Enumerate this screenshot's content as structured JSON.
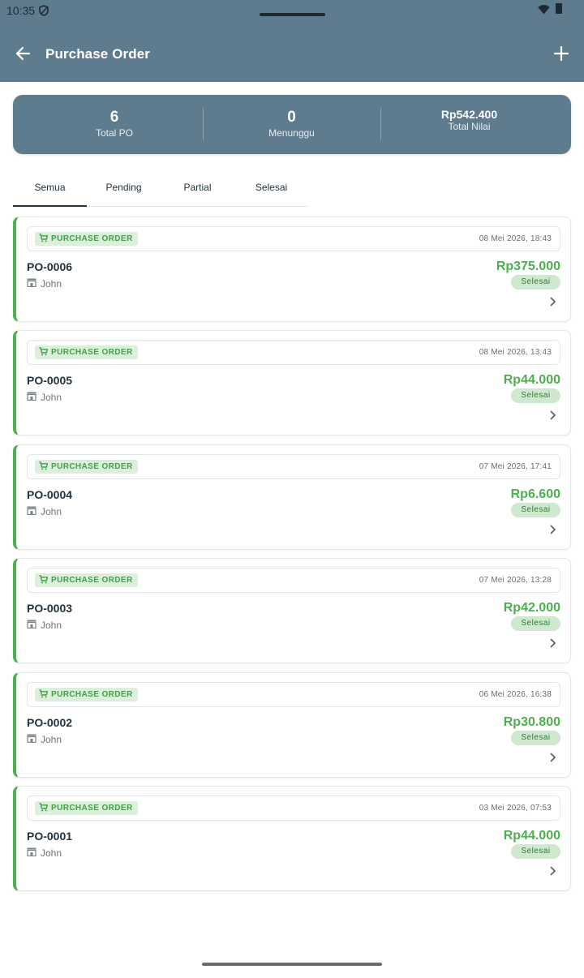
{
  "status_bar": {
    "time": "10:35"
  },
  "app_bar": {
    "title": "Purchase Order"
  },
  "summary": {
    "total_po": {
      "value": "6",
      "label": "Total PO"
    },
    "menunggu": {
      "value": "0",
      "label": "Menunggu"
    },
    "total_nilai": {
      "value": "Rp542.400",
      "label": "Total Nilai"
    }
  },
  "tabs": [
    {
      "label": "Semua",
      "active": true
    },
    {
      "label": "Pending",
      "active": false
    },
    {
      "label": "Partial",
      "active": false
    },
    {
      "label": "Selesai",
      "active": false
    }
  ],
  "orders": [
    {
      "type": "PURCHASE ORDER",
      "date": "08 Mei 2026, 18:43",
      "number": "PO-0006",
      "supplier": "John",
      "amount": "Rp375.000",
      "status": "Selesai"
    },
    {
      "type": "PURCHASE ORDER",
      "date": "08 Mei 2026, 13:43",
      "number": "PO-0005",
      "supplier": "John",
      "amount": "Rp44.000",
      "status": "Selesai"
    },
    {
      "type": "PURCHASE ORDER",
      "date": "07 Mei 2026, 17:41",
      "number": "PO-0004",
      "supplier": "John",
      "amount": "Rp6.600",
      "status": "Selesai"
    },
    {
      "type": "PURCHASE ORDER",
      "date": "07 Mei 2026, 13:28",
      "number": "PO-0003",
      "supplier": "John",
      "amount": "Rp42.000",
      "status": "Selesai"
    },
    {
      "type": "PURCHASE ORDER",
      "date": "06 Mei 2026, 16:38",
      "number": "PO-0002",
      "supplier": "John",
      "amount": "Rp30.800",
      "status": "Selesai"
    },
    {
      "type": "PURCHASE ORDER",
      "date": "03 Mei 2026, 07:53",
      "number": "PO-0001",
      "supplier": "John",
      "amount": "Rp44.000",
      "status": "Selesai"
    }
  ],
  "icons": {
    "back": "arrow-left-icon",
    "add": "plus-icon",
    "order_type": "shopping-cart-icon",
    "supplier": "store-icon",
    "open": "chevron-right-icon"
  },
  "colors": {
    "app_bar": "#5f7b8e",
    "accent_green": "#4caf50",
    "status_badge_bg": "#cfe8cf",
    "type_badge_bg": "#dcefdc",
    "text_dark": "#24333d"
  }
}
